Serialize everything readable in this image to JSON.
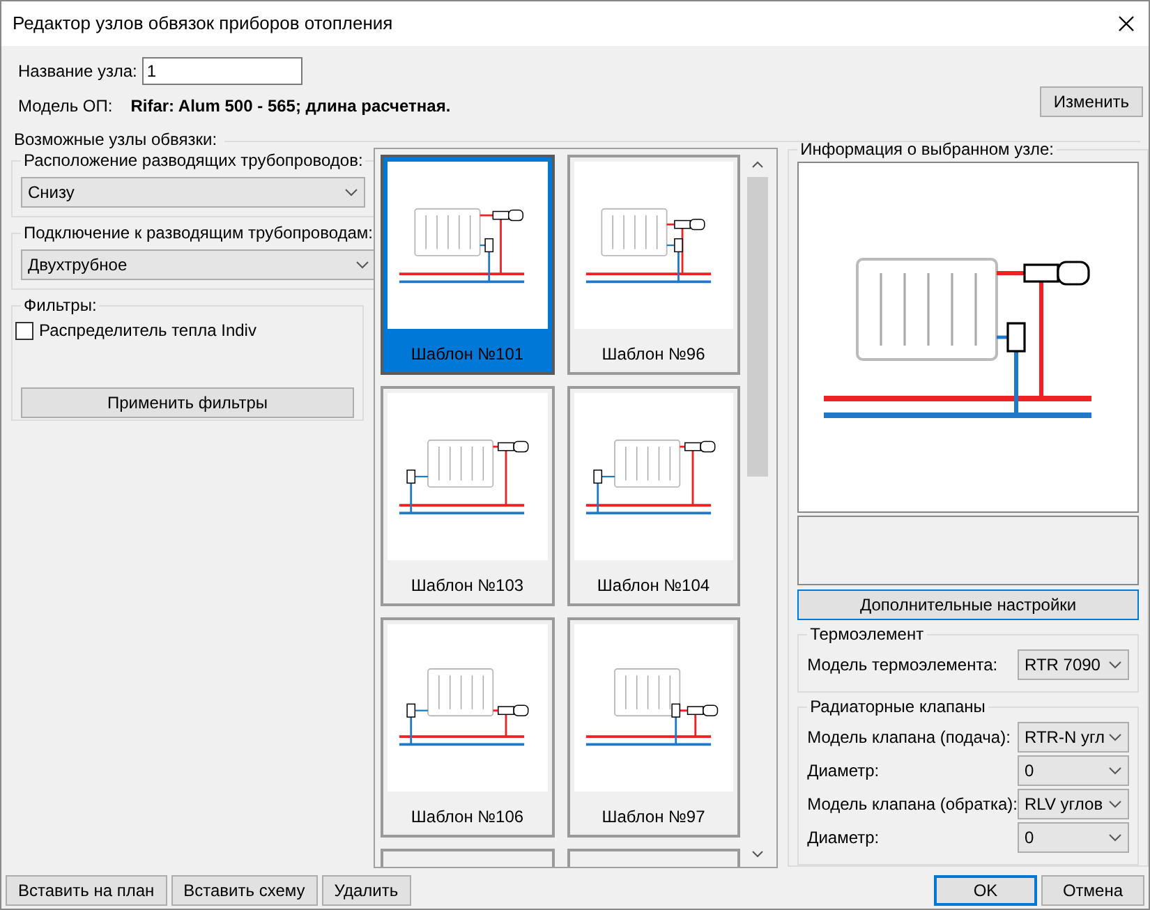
{
  "window": {
    "title": "Редактор узлов обвязок приборов отопления"
  },
  "node_name": {
    "label": "Название узла:",
    "value": "1"
  },
  "model": {
    "label": "Модель ОП:",
    "value": "Rifar: Alum 500 - 565; длина расчетная."
  },
  "change_button": "Изменить",
  "nodes_section": {
    "title": "Возможные узлы обвязки:",
    "pipe_location": {
      "title": "Расположение разводящих трубопроводов:",
      "value": "Снизу"
    },
    "connection": {
      "title": "Подключение к разводящим трубопроводам:",
      "value": "Двухтрубное"
    },
    "filters": {
      "title": "Фильтры:",
      "items": [
        {
          "label": "Распределитель тепла Indiv",
          "checked": false
        }
      ],
      "apply_button": "Применить фильтры"
    }
  },
  "templates": [
    {
      "label": "Шаблон №101",
      "kind": "top-right",
      "selected": true
    },
    {
      "label": "Шаблон №96",
      "kind": "stacked-right",
      "selected": false
    },
    {
      "label": "Шаблон №103",
      "kind": "top-right-left-return",
      "selected": false
    },
    {
      "label": "Шаблон №104",
      "kind": "top-right-left-return",
      "selected": false
    },
    {
      "label": "Шаблон №106",
      "kind": "bottom-both-sides",
      "selected": false
    },
    {
      "label": "Шаблон №97",
      "kind": "bottom-right-pair",
      "selected": false
    }
  ],
  "info": {
    "title": "Информация о выбранном узле:",
    "preview": {
      "kind": "top-right"
    },
    "settings_button": "Дополнительные настройки",
    "groups": [
      {
        "title": "Термоэлемент",
        "fields": [
          {
            "label": "Модель термоэлемента:",
            "value": "RTR 7090"
          }
        ]
      },
      {
        "title": "Радиаторные клапаны",
        "fields": [
          {
            "label": "Модель клапана (подача):",
            "value": "RTR-N угл"
          },
          {
            "label": "Диаметр:",
            "value": "0"
          },
          {
            "label": "Модель клапана (обратка):",
            "value": "RLV углов"
          },
          {
            "label": "Диаметр:",
            "value": "0"
          }
        ]
      }
    ]
  },
  "bottom_left_buttons": [
    "Вставить на план",
    "Вставить схему",
    "Удалить"
  ],
  "bottom_right_buttons": [
    {
      "label": "OK",
      "default": true
    },
    {
      "label": "Отмена",
      "default": false
    }
  ]
}
